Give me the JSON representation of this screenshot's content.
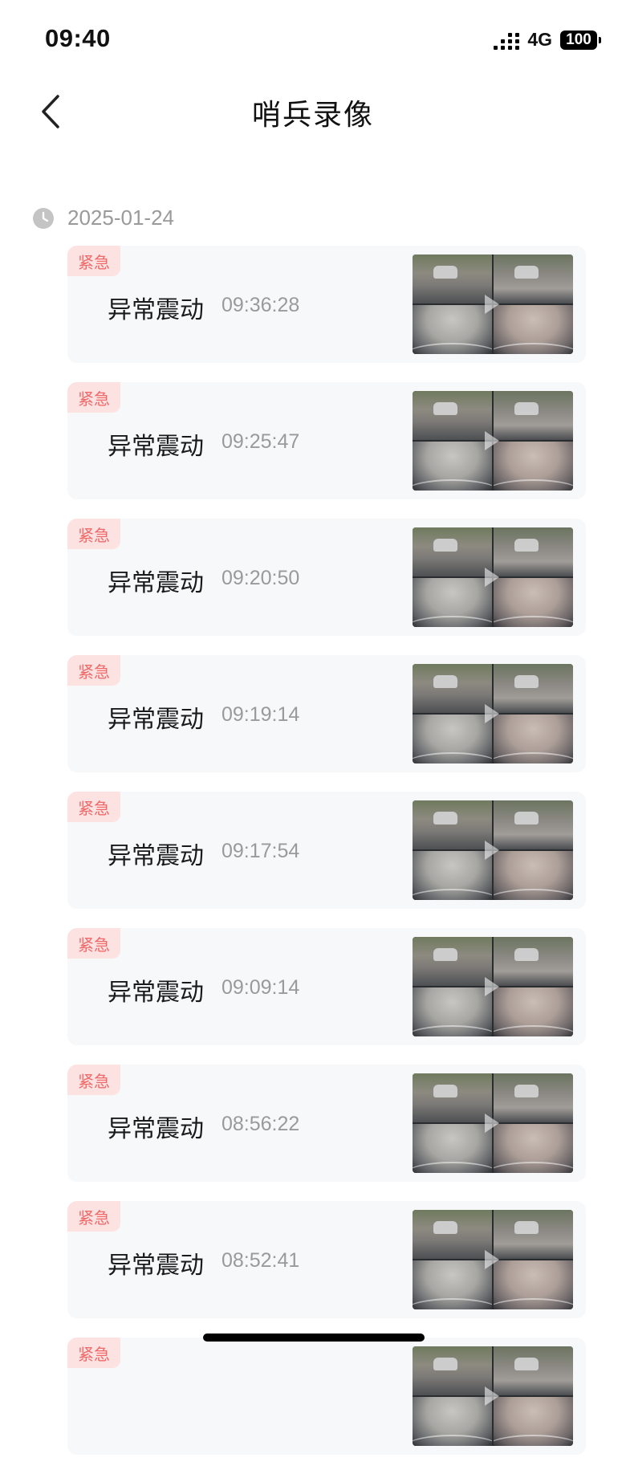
{
  "status_bar": {
    "time": "09:40",
    "network": "4G",
    "battery": "100"
  },
  "nav": {
    "title": "哨兵录像"
  },
  "date_group": {
    "date": "2025-01-24"
  },
  "recordings": [
    {
      "badge": "紧急",
      "label": "异常震动",
      "time": "09:36:28"
    },
    {
      "badge": "紧急",
      "label": "异常震动",
      "time": "09:25:47"
    },
    {
      "badge": "紧急",
      "label": "异常震动",
      "time": "09:20:50"
    },
    {
      "badge": "紧急",
      "label": "异常震动",
      "time": "09:19:14"
    },
    {
      "badge": "紧急",
      "label": "异常震动",
      "time": "09:17:54"
    },
    {
      "badge": "紧急",
      "label": "异常震动",
      "time": "09:09:14"
    },
    {
      "badge": "紧急",
      "label": "异常震动",
      "time": "08:56:22"
    },
    {
      "badge": "紧急",
      "label": "异常震动",
      "time": "08:52:41"
    },
    {
      "badge": "紧急",
      "label": "",
      "time": ""
    }
  ],
  "colors": {
    "badge_bg": "#fde2e2",
    "badge_text": "#f06a6a",
    "card_bg": "#f7f8fa",
    "muted_text": "#9a9a9a"
  },
  "icons": {
    "back": "chevron-left-icon",
    "clock": "clock-icon",
    "signal": "signal-icon",
    "battery": "battery-icon",
    "play": "play-icon"
  }
}
